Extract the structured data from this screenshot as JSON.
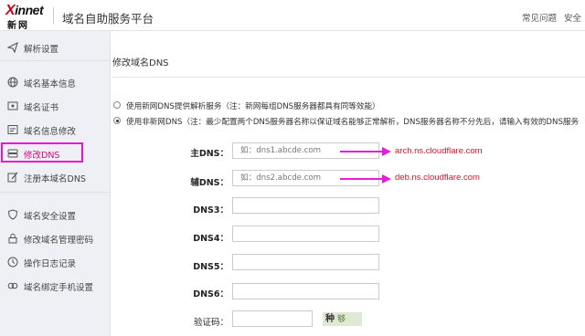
{
  "header": {
    "logo_top": "innet",
    "logo_x": "X",
    "logo_bottom": "新网",
    "title": "域名自助服务平台",
    "links": [
      "常见问题",
      "安全"
    ]
  },
  "sidebar": {
    "items": [
      {
        "label": "解析设置",
        "icon": "send-icon"
      },
      {
        "label": "域名基本信息",
        "icon": "globe-icon"
      },
      {
        "label": "域名证书",
        "icon": "certificate-icon"
      },
      {
        "label": "域名信息修改",
        "icon": "id-card-icon"
      },
      {
        "label": "修改DNS",
        "icon": "server-icon"
      },
      {
        "label": "注册本域名DNS",
        "icon": "edit-icon"
      },
      {
        "label": "域名安全设置",
        "icon": "shield-icon"
      },
      {
        "label": "修改域名管理密码",
        "icon": "lock-icon"
      },
      {
        "label": "操作日志记录",
        "icon": "clock-icon"
      },
      {
        "label": "域名绑定手机设置",
        "icon": "link-icon"
      }
    ],
    "active_index": 4
  },
  "main": {
    "title": "修改域名DNS",
    "radio_options": [
      {
        "label": "使用新网DNS提供解析服务（注：新网每组DNS服务器都具有同等效能）",
        "checked": false
      },
      {
        "label": "使用非新网DNS（注：最少配置两个DNS服务器名称以保证域名能够正常解析，DNS服务器名称不分先后，请输入有效的DNS服务",
        "checked": true
      }
    ],
    "fields": [
      {
        "label": "主DNS：",
        "value": "",
        "placeholder": "如：dns1.abcde.com"
      },
      {
        "label": "辅DNS：",
        "value": "",
        "placeholder": "如：dns2.abcde.com"
      },
      {
        "label": "DNS3：",
        "value": "",
        "placeholder": ""
      },
      {
        "label": "DNS4：",
        "value": "",
        "placeholder": ""
      },
      {
        "label": "DNS5：",
        "value": "",
        "placeholder": ""
      },
      {
        "label": "DNS6：",
        "value": "",
        "placeholder": ""
      }
    ],
    "captcha": {
      "label": "验证码：",
      "value": "",
      "image_text_1": "种",
      "image_text_2": "够"
    }
  },
  "annotations": {
    "primary": "arch.ns.cloudflare.com",
    "secondary": "deb.ns.cloudflare.com",
    "color": "#e0102c",
    "arrow_color": "#e61eda",
    "highlight_color": "#e815d8"
  },
  "colors": {
    "active_nav": "#e6007e",
    "sidebar_bg": "#eef0f5"
  }
}
